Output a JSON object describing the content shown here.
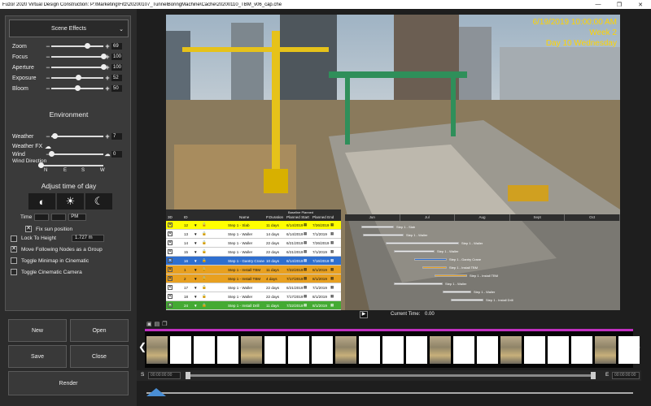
{
  "window": {
    "title": "Fuzor 2020 Virtual Design Construction: P:\\Marketing\\Fitz\\20200107_TunnelBoringMachine\\Cache\\20200110_TBM_v06_cap.che",
    "minimize": "—",
    "maximize": "❐",
    "close": "✕"
  },
  "scene_panel": {
    "dropdown_label": "Scene Effects",
    "sliders": [
      {
        "label": "Zoom",
        "value": "69",
        "fraction": 0.69
      },
      {
        "label": "Focus",
        "value": "100",
        "fraction": 1.0
      },
      {
        "label": "Aperture",
        "value": "100",
        "fraction": 1.0
      },
      {
        "label": "Exposure",
        "value": "52",
        "fraction": 0.52
      },
      {
        "label": "Bloom",
        "value": "50",
        "fraction": 0.5
      }
    ],
    "environment_title": "Environment",
    "weather": {
      "label": "Weather",
      "value": "7",
      "fraction": 0.07
    },
    "weather_fx_label": "Weather FX",
    "wind": {
      "label": "Wind",
      "value": "0",
      "fraction": 0.0
    },
    "wind_direction_label": "Wind Direction",
    "compass": [
      "N",
      "E",
      "S",
      "W"
    ],
    "adjust_time_title": "Adjust time of day",
    "time_label": "Time",
    "time_hour": "",
    "time_minute": "",
    "time_ampm": "PM",
    "checks": [
      {
        "label": "Fix sun position",
        "checked": true
      },
      {
        "label": "Lock To Height",
        "checked": false
      },
      {
        "label": "Move Following Nodes as a Group",
        "checked": true
      },
      {
        "label": "Toggle Minimap in Cinematic",
        "checked": false
      },
      {
        "label": "Toggle Cinematic Camera",
        "checked": false
      }
    ],
    "lock_height_value": "1.727 m"
  },
  "buttons": {
    "new": "New",
    "open": "Open",
    "save": "Save",
    "close": "Close",
    "render": "Render"
  },
  "viewport": {
    "datetime": "6/19/2019 10:00:00 AM",
    "week": "Week 2",
    "day": "Day 10 Wednesday"
  },
  "gantt": {
    "group_header": "Baseline Planned",
    "columns": [
      "3D",
      "ID",
      "Name",
      "P.Duration",
      "Planned Start",
      "Planned End"
    ],
    "months": [
      "Jun",
      "Jul",
      "Aug",
      "Sept",
      "Oct"
    ],
    "rows": [
      {
        "id": "12",
        "name": "Step 1 - Slab",
        "duration": "11 days",
        "start": "6/14/2019",
        "end": "7/26/2019",
        "color": "#ffff00"
      },
      {
        "id": "13",
        "name": "Step 1 - Waller",
        "duration": "14 days",
        "start": "6/14/2019",
        "end": "7/1/2019",
        "color": "#ffffff"
      },
      {
        "id": "14",
        "name": "Step 1 - Waller",
        "duration": "22 days",
        "start": "6/21/2019",
        "end": "7/26/2019",
        "color": "#ffffff"
      },
      {
        "id": "15",
        "name": "Step 1 - Waller",
        "duration": "22 days",
        "start": "6/21/2019",
        "end": "7/1/2019",
        "color": "#ffffff"
      },
      {
        "id": "16",
        "name": "Step 1 - Gantry Crane",
        "duration": "10 days",
        "start": "6/14/2019",
        "end": "7/16/2019",
        "color": "#2f6fcf"
      },
      {
        "id": "1",
        "name": "Step 1 - Install TBM",
        "duration": "11 days",
        "start": "7/22/2019",
        "end": "8/1/2019",
        "color": "#e8a020"
      },
      {
        "id": "2",
        "name": "Step 1 - Install TBM",
        "duration": "4 days",
        "start": "7/17/2019",
        "end": "8/1/2019",
        "color": "#e8a020"
      },
      {
        "id": "17",
        "name": "Step 1 - Waller",
        "duration": "22 days",
        "start": "6/21/2019",
        "end": "7/1/2019",
        "color": "#ffffff"
      },
      {
        "id": "18",
        "name": "Step 1 - Waller",
        "duration": "22 days",
        "start": "7/17/2019",
        "end": "8/1/2019",
        "color": "#ffffff"
      },
      {
        "id": "24",
        "name": "Step 1 - Install Drill",
        "duration": "11 days",
        "start": "7/22/2019",
        "end": "8/1/2019",
        "color": "#44aa33"
      }
    ],
    "bar_labels": [
      "Step 1 - Slab",
      "Step 1 - Waller",
      "Step 1 - Waller",
      "Step 1 - Waller",
      "Step 1 - Gantry Crane",
      "Step 1 - Install TBM",
      "Step 1 - Install TBM",
      "Step 1 - Waller",
      "Step 1 - Waller",
      "Step 1 - Install Drill"
    ]
  },
  "timeline": {
    "current_time_label": "Current Time:",
    "current_time_value": "0.00",
    "start_label": "S",
    "end_label": "E",
    "start_tc": "00:00:00:00",
    "end_tc": "00:00:00:00",
    "play_icon": "▶",
    "prev_arrow": "❮",
    "next_arrow": "❯"
  }
}
